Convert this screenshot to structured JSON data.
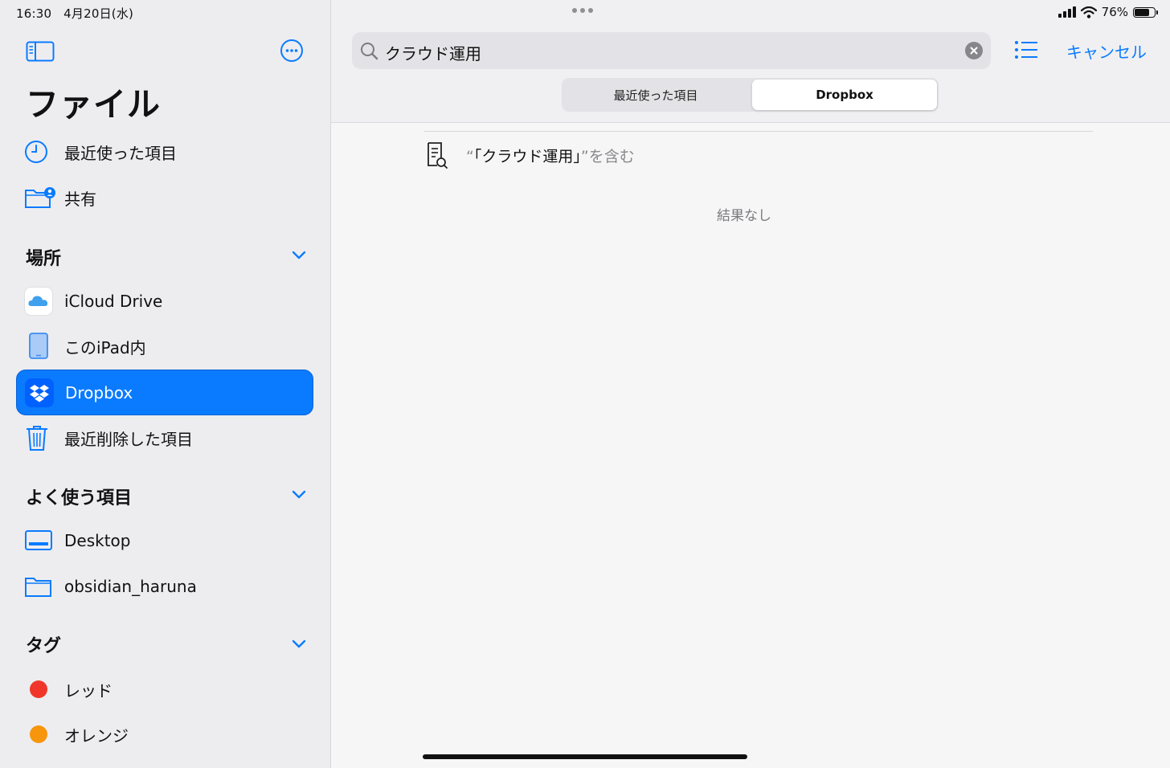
{
  "status": {
    "time": "16:30",
    "date": "4月20日(水)",
    "battery": "76%",
    "battery_level": 0.76
  },
  "sidebar": {
    "title": "ファイル",
    "top_items": [
      {
        "label": "最近使った項目",
        "icon": "clock-icon"
      },
      {
        "label": "共有",
        "icon": "shared-folder-icon"
      }
    ],
    "sections": {
      "locations": {
        "title": "場所",
        "items": [
          {
            "label": "iCloud Drive",
            "icon": "icloud-icon"
          },
          {
            "label": "このiPad内",
            "icon": "ipad-icon"
          },
          {
            "label": "Dropbox",
            "icon": "dropbox-icon",
            "selected": true
          },
          {
            "label": "最近削除した項目",
            "icon": "trash-icon"
          }
        ]
      },
      "favorites": {
        "title": "よく使う項目",
        "items": [
          {
            "label": "Desktop",
            "icon": "desktop-icon"
          },
          {
            "label": "obsidian_haruna",
            "icon": "folder-icon"
          }
        ]
      },
      "tags": {
        "title": "タグ",
        "items": [
          {
            "label": "レッド",
            "color": "#f0362b"
          },
          {
            "label": "オレンジ",
            "color": "#f7960c"
          }
        ]
      }
    }
  },
  "search": {
    "value": "クラウド運用",
    "cancel_label": "キャンセル"
  },
  "scope": {
    "tabs": [
      {
        "label": "最近使った項目"
      },
      {
        "label": "Dropbox",
        "selected": true
      }
    ]
  },
  "suggestion": {
    "prefix": "“",
    "query": "「クラウド運用」",
    "suffix": "”を含む"
  },
  "results": {
    "empty_text": "結果なし"
  },
  "colors": {
    "accent": "#0a7bff",
    "sidebar_bg": "#ededf0"
  }
}
